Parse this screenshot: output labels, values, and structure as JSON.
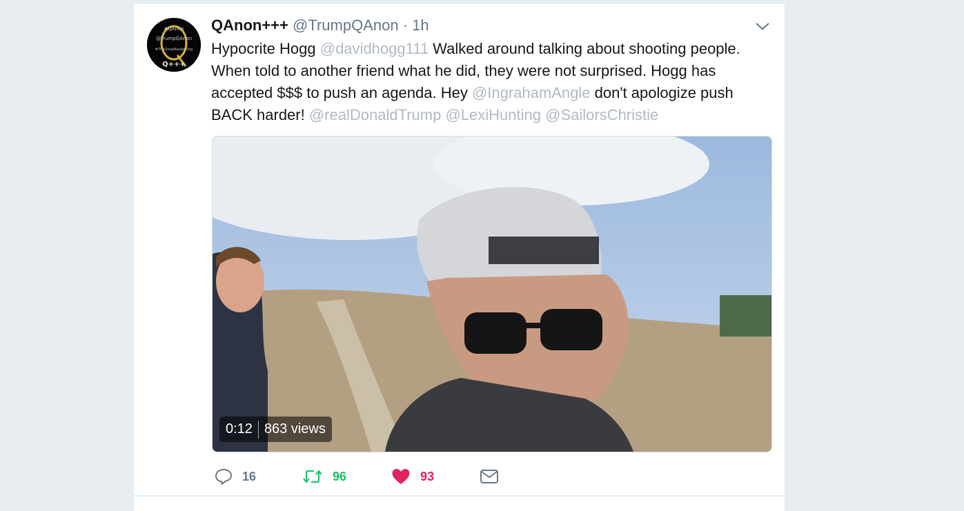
{
  "tweet": {
    "display_name": "QAnon+++",
    "handle": "@TrumpQAnon",
    "separator": "·",
    "timestamp": "1h",
    "text_segments": [
      {
        "text": "Hypocrite Hogg ",
        "mention": false
      },
      {
        "text": "@davidhogg111",
        "mention": true
      },
      {
        "text": " Walked around talking about shooting people. When told to another friend what he did, they were not surprised. Hogg has accepted $$$ to push an agenda. Hey ",
        "mention": false
      },
      {
        "text": "@IngrahamAngle",
        "mention": true
      },
      {
        "text": " don't apologize push BACK harder! ",
        "mention": false
      },
      {
        "text": "@realDonaldTrump",
        "mention": true
      },
      {
        "text": " ",
        "mention": false
      },
      {
        "text": "@LexiHunting",
        "mention": true
      },
      {
        "text": " ",
        "mention": false
      },
      {
        "text": "@SailorsChristie",
        "mention": true
      }
    ],
    "avatar": {
      "icon": "q-logo-avatar",
      "lines": [
        "#QAnon",
        "@TrumpQAnon",
        "#TheGreatAwakening",
        "Q+++"
      ]
    }
  },
  "video": {
    "duration": "0:12",
    "views": "863 views"
  },
  "actions": {
    "reply": {
      "icon": "reply-icon",
      "count": "16"
    },
    "retweet": {
      "icon": "retweet-icon",
      "count": "96"
    },
    "like": {
      "icon": "heart-icon",
      "count": "93"
    },
    "dm": {
      "icon": "envelope-icon"
    }
  },
  "colors": {
    "background": "#e6ecf0",
    "text": "#14171a",
    "muted": "#657786",
    "mention": "#b0b9c3",
    "retweet_green": "#17bf63",
    "like_red": "#e0245e"
  }
}
